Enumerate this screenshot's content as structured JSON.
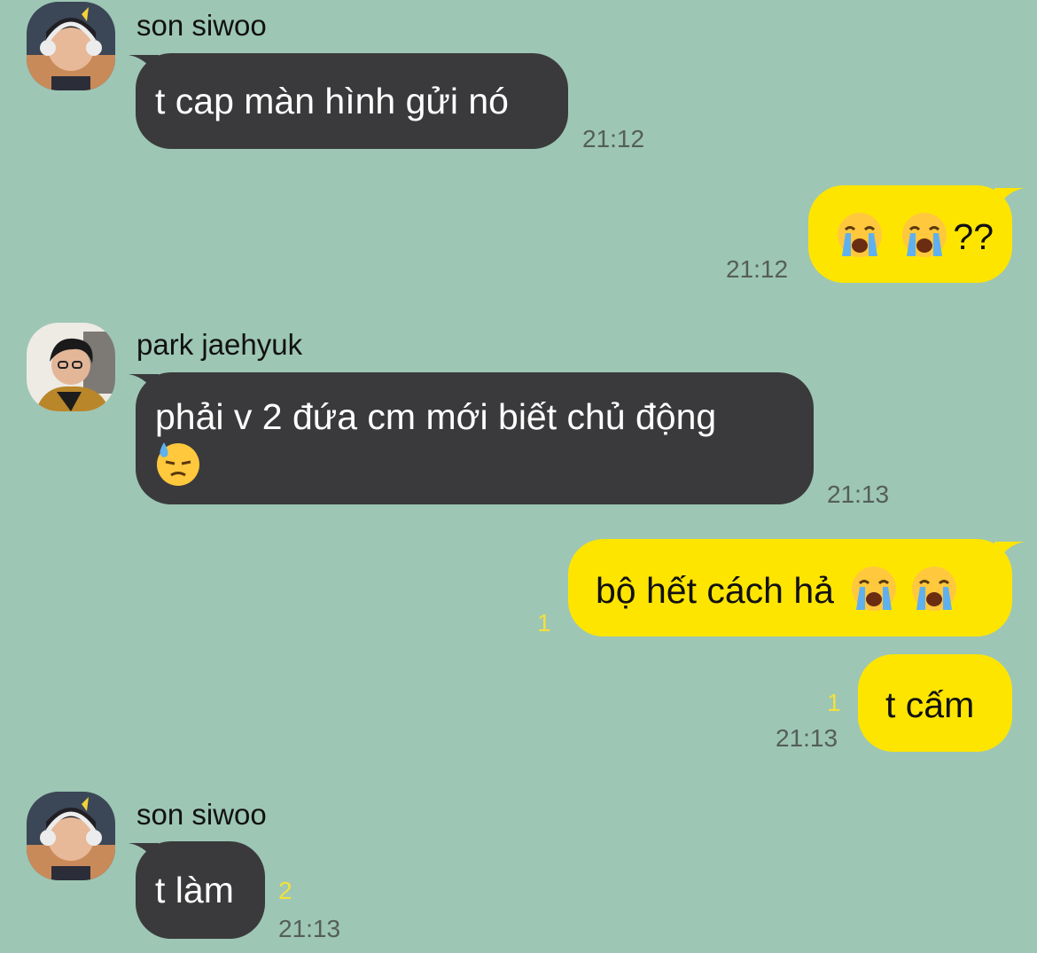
{
  "colors": {
    "background": "#9dc6b5",
    "incoming_bubble": "#3a3a3c",
    "outgoing_bubble": "#fee500",
    "unread_count": "#f4e03a",
    "timestamp": "#555e5a"
  },
  "messages": [
    {
      "direction": "incoming",
      "sender": "son siwoo",
      "avatar": "avatar-son-siwoo",
      "text": "t cap màn hình gửi nó",
      "time": "21:12"
    },
    {
      "direction": "outgoing",
      "emoji": [
        "loudly-crying-face-icon",
        "loudly-crying-face-icon"
      ],
      "text": "??",
      "time": "21:12"
    },
    {
      "direction": "incoming",
      "sender": "park jaehyuk",
      "avatar": "avatar-park-jaehyuk",
      "text": "phải v 2 đứa cm mới biết chủ động",
      "emoji": [
        "downcast-face-with-sweat-icon"
      ],
      "time": "21:13"
    },
    {
      "direction": "outgoing",
      "text": "bộ hết cách hả",
      "emoji": [
        "loudly-crying-face-icon",
        "loudly-crying-face-icon"
      ],
      "unread": "1"
    },
    {
      "direction": "outgoing",
      "text": "t cấm",
      "unread": "1",
      "time": "21:13"
    },
    {
      "direction": "incoming",
      "sender": "son siwoo",
      "avatar": "avatar-son-siwoo",
      "text": "t làm",
      "unread": "2",
      "time": "21:13"
    }
  ]
}
